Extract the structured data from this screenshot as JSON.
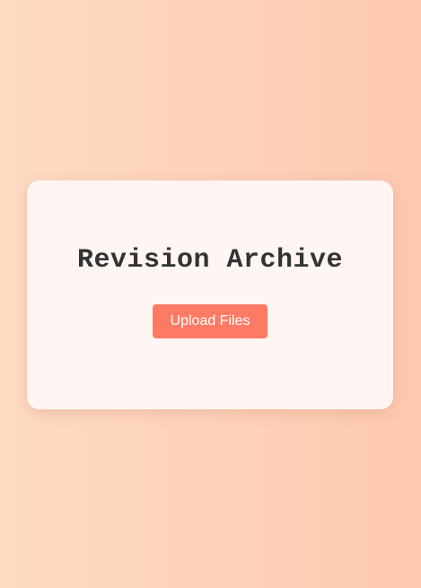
{
  "card": {
    "title": "Revision Archive",
    "upload_button_label": "Upload Files"
  },
  "colors": {
    "background_start": "#fedac3",
    "background_end": "#fdc8ae",
    "card_background": "#fff5f2",
    "accent": "#fe7a64",
    "title_text": "#333333"
  }
}
